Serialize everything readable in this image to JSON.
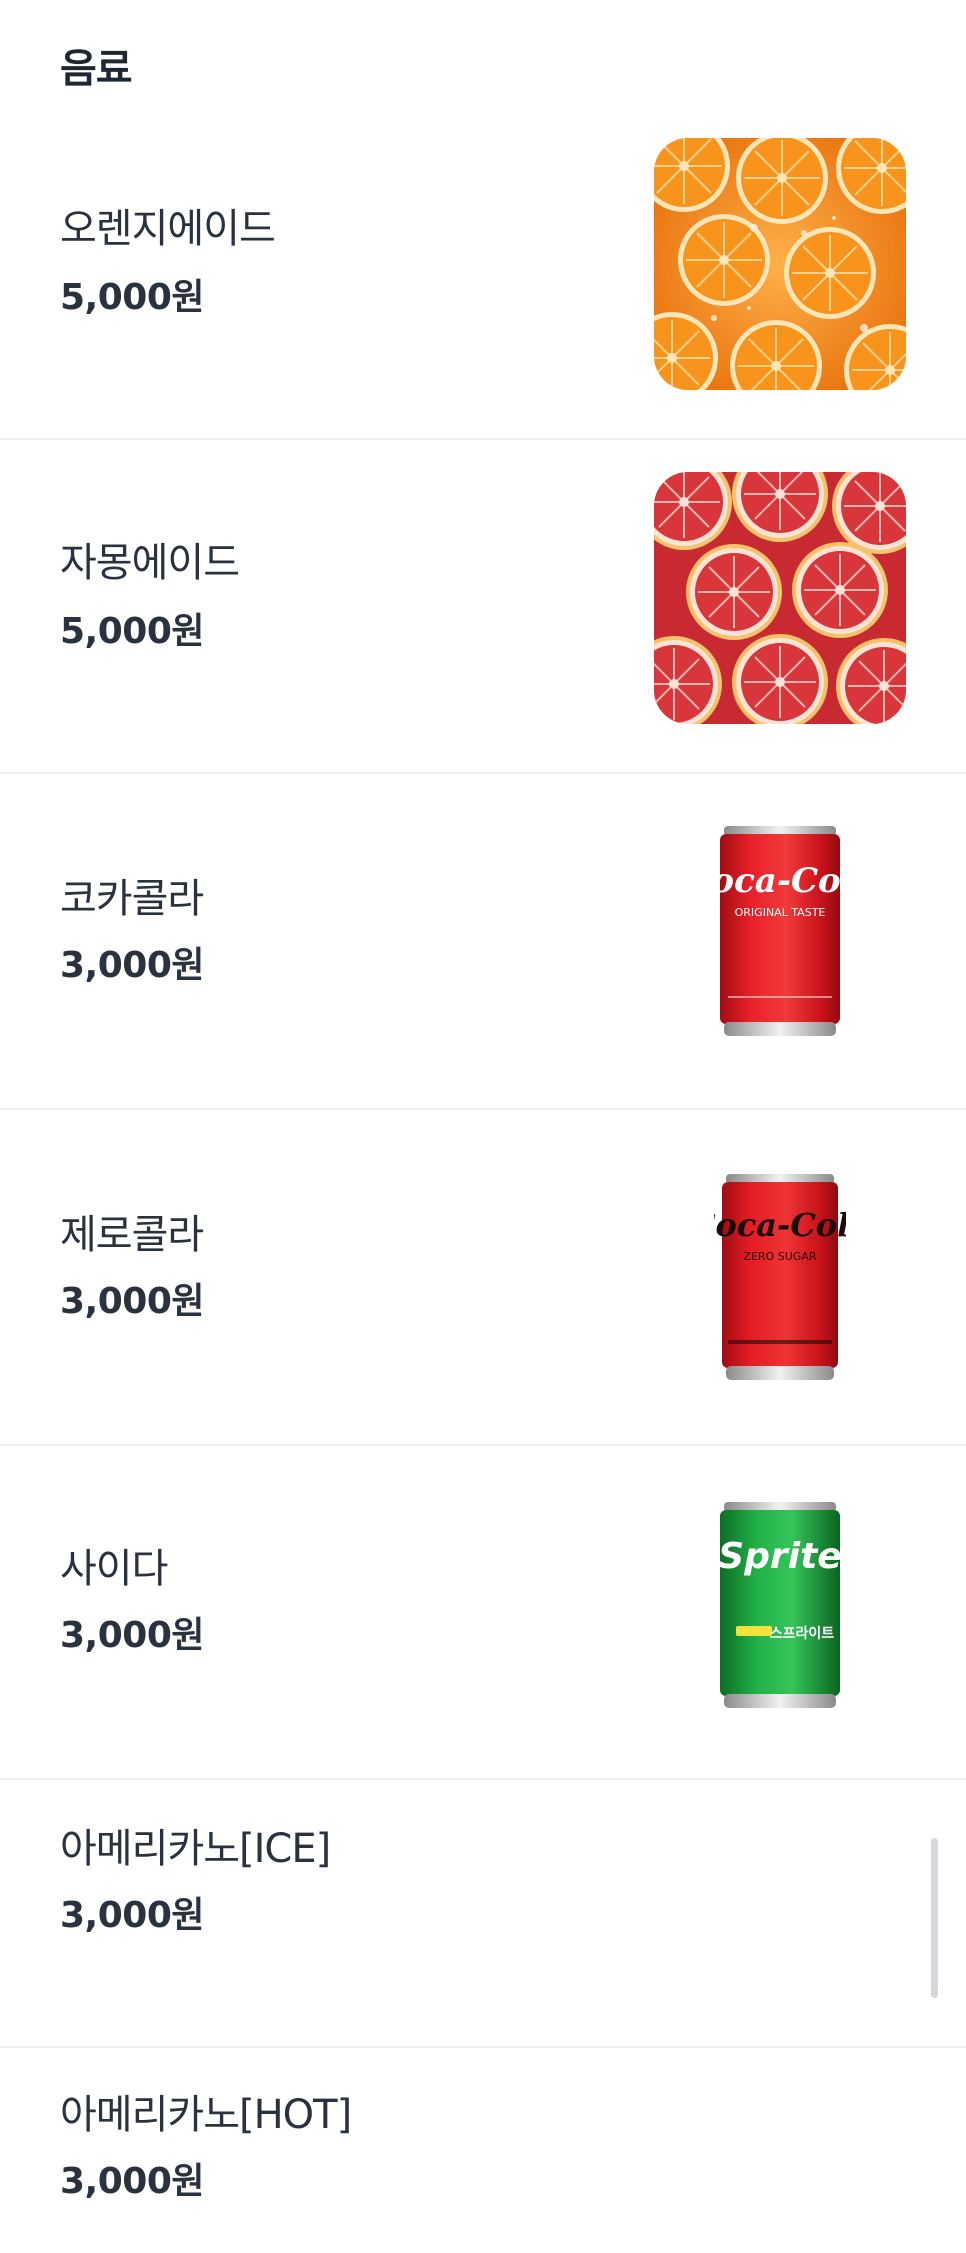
{
  "section": {
    "title": "음료"
  },
  "items": [
    {
      "name": "오렌지에이드",
      "price": "5,000원",
      "image": "orange-slices-photo"
    },
    {
      "name": "자몽에이드",
      "price": "5,000원",
      "image": "grapefruit-slices-photo"
    },
    {
      "name": "코카콜라",
      "price": "3,000원",
      "image": "coca-cola-can-photo",
      "can_brand": "Coca-Cola",
      "can_sub": "ORIGINAL TASTE"
    },
    {
      "name": "제로콜라",
      "price": "3,000원",
      "image": "coca-cola-zero-can-photo",
      "can_brand": "Coca-Cola",
      "can_sub": "ZERO SUGAR"
    },
    {
      "name": "사이다",
      "price": "3,000원",
      "image": "sprite-can-photo",
      "can_brand": "Sprite",
      "can_sub": "스프라이트"
    },
    {
      "name": "아메리카노[ICE]",
      "price": "3,000원"
    },
    {
      "name": "아메리카노[HOT]",
      "price": "3,000원"
    }
  ],
  "colors": {
    "text": "#222a36",
    "divider": "#eef0f3",
    "coke_red": "#e0141e",
    "sprite_green": "#1ea83c",
    "orange": "#f7931e",
    "grapefruit": "#d83a3a"
  }
}
